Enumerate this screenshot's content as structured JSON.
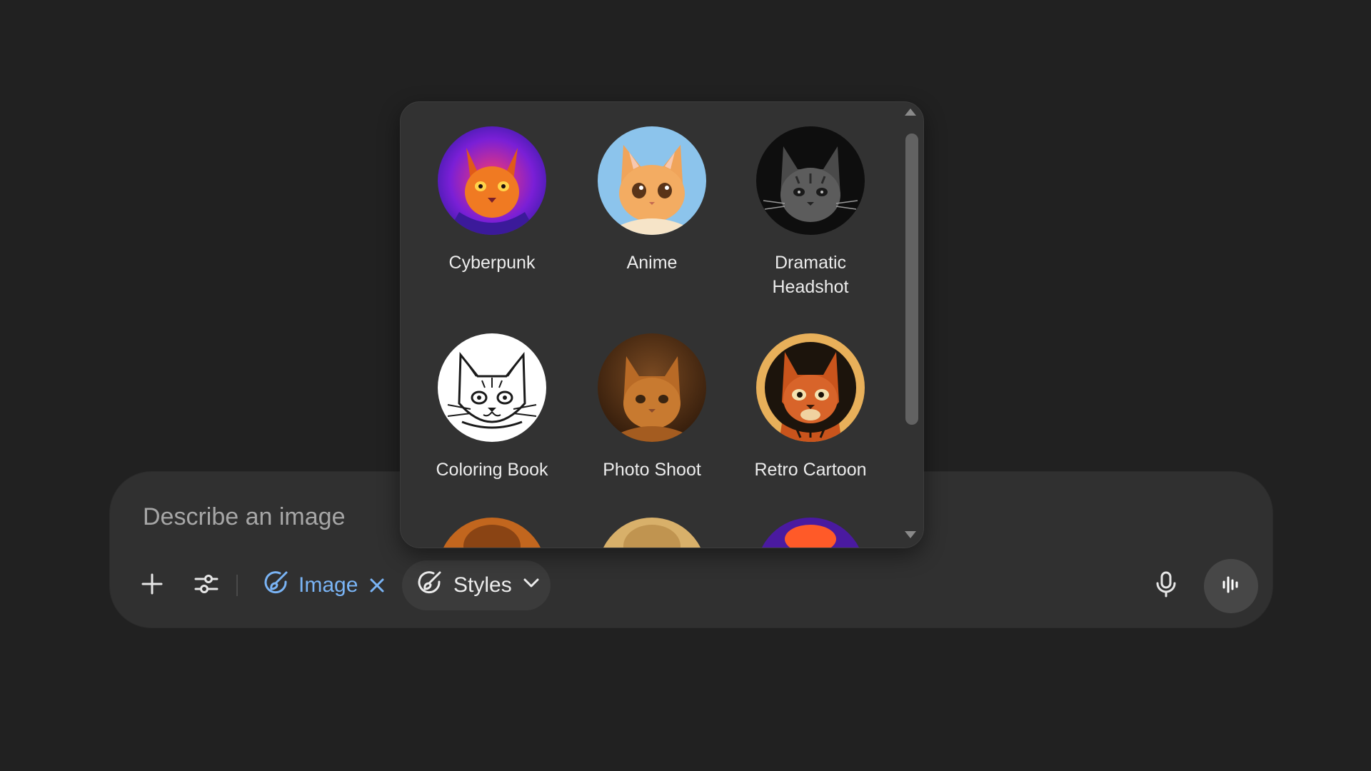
{
  "composer": {
    "placeholder": "Describe an image",
    "image_chip_label": "Image",
    "styles_label": "Styles"
  },
  "styles_panel": {
    "items": [
      {
        "label": "Cyberpunk"
      },
      {
        "label": "Anime"
      },
      {
        "label": "Dramatic Headshot"
      },
      {
        "label": "Coloring Book"
      },
      {
        "label": "Photo Shoot"
      },
      {
        "label": "Retro Cartoon"
      }
    ]
  },
  "icons": {
    "add": "plus-icon",
    "tools": "sliders-icon",
    "image": "paintbrush-icon",
    "close": "close-icon",
    "styles": "paintbrush-icon",
    "dropdown": "chevron-down-icon",
    "mic": "microphone-icon",
    "voice": "voice-mode-icon",
    "scroll_up": "scroll-up-arrow-icon",
    "scroll_down": "scroll-down-arrow-icon"
  },
  "colors": {
    "background": "#212121",
    "composer": "#303030",
    "panel": "#323232",
    "accent": "#7ab4f5",
    "text": "#ececec"
  }
}
